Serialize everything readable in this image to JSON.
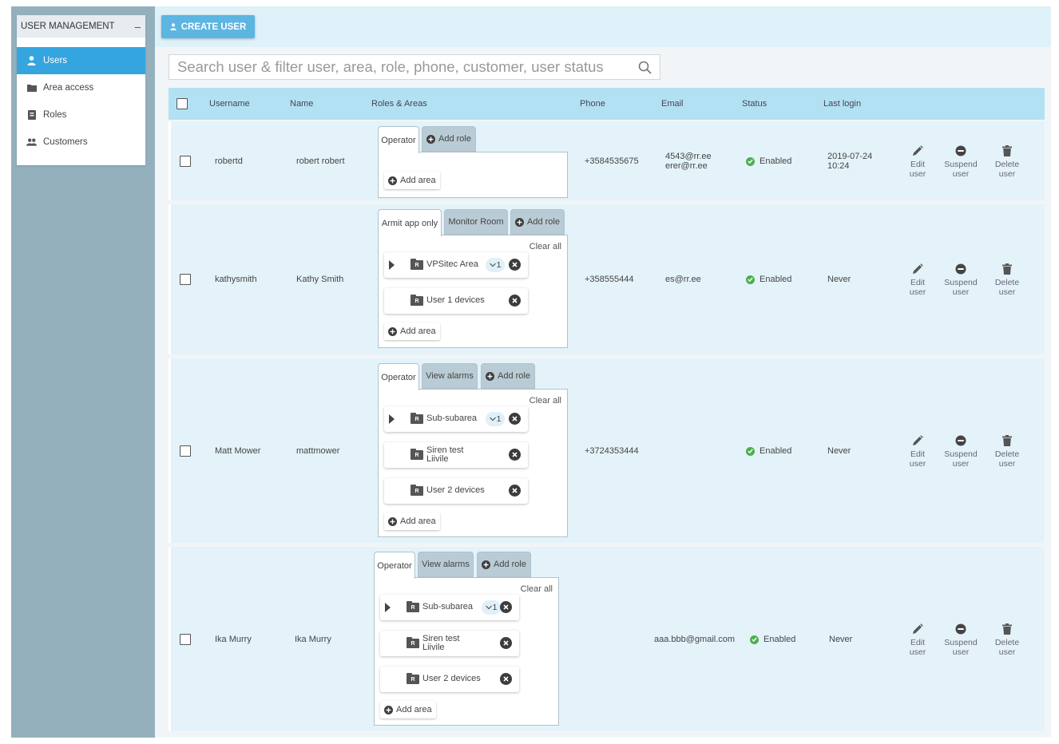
{
  "sidebar": {
    "title": "USER MANAGEMENT",
    "collapse_symbol": "–",
    "items": [
      {
        "label": "Users",
        "icon": "user-icon",
        "active": true
      },
      {
        "label": "Area access",
        "icon": "folder-icon"
      },
      {
        "label": "Roles",
        "icon": "id-card-icon"
      },
      {
        "label": "Customers",
        "icon": "users-icon"
      }
    ]
  },
  "toolbar": {
    "create_label": "CREATE USER"
  },
  "search": {
    "placeholder": "Search user & filter user, area, role, phone, customer, user status"
  },
  "table": {
    "headers": {
      "username": "Username",
      "name": "Name",
      "roles": "Roles & Areas",
      "phone": "Phone",
      "email": "Email",
      "status": "Status",
      "last_login": "Last login"
    },
    "actions": {
      "edit": [
        "Edit",
        "user"
      ],
      "suspend": [
        "Suspend",
        "user"
      ],
      "delete": [
        "Delete",
        "user"
      ]
    },
    "labels": {
      "add_role": "Add role",
      "add_area": "Add area",
      "clear_all": "Clear all",
      "folder_badge": "R"
    },
    "rows": [
      {
        "username": "robertd",
        "name": "robert robert",
        "phone": "+3584535675",
        "email_lines": [
          "4543@rr.ee",
          "erer@rr.ee"
        ],
        "status": "Enabled",
        "last_login_lines": [
          "2019-07-24",
          "10:24"
        ],
        "roles": [
          "Operator"
        ],
        "areas": []
      },
      {
        "username": "kathysmith",
        "name": "Kathy Smith",
        "phone": "+358555444",
        "email_lines": [
          "es@rr.ee"
        ],
        "status": "Enabled",
        "last_login_lines": [
          "Never"
        ],
        "roles": [
          "Armit app only",
          "Monitor Room"
        ],
        "areas": [
          {
            "name": [
              "VPSitec Area"
            ],
            "count": "1",
            "expandable": true
          },
          {
            "name": [
              "User 1 devices"
            ]
          }
        ]
      },
      {
        "username": "Matt Mower",
        "name": "mattmower",
        "phone": "+3724353444",
        "email_lines": [],
        "status": "Enabled",
        "last_login_lines": [
          "Never"
        ],
        "roles": [
          "Operator",
          "View alarms"
        ],
        "areas": [
          {
            "name": [
              "Sub-subarea"
            ],
            "count": "1",
            "expandable": true
          },
          {
            "name": [
              "Siren test",
              "Liivile"
            ]
          },
          {
            "name": [
              "User 2 devices"
            ]
          }
        ]
      },
      {
        "username": "Ika Murry",
        "name": "Ika Murry",
        "phone": "",
        "email_lines": [
          "aaa.bbb@gmail.com"
        ],
        "status": "Enabled",
        "last_login_lines": [
          "Never"
        ],
        "roles": [
          "Operator",
          "View alarms"
        ],
        "areas": [
          {
            "name": [
              "Sub-subarea"
            ],
            "count": "1",
            "expandable": true
          },
          {
            "name": [
              "Siren test",
              "Liivile"
            ]
          },
          {
            "name": [
              "User 2 devices"
            ]
          }
        ]
      }
    ]
  }
}
